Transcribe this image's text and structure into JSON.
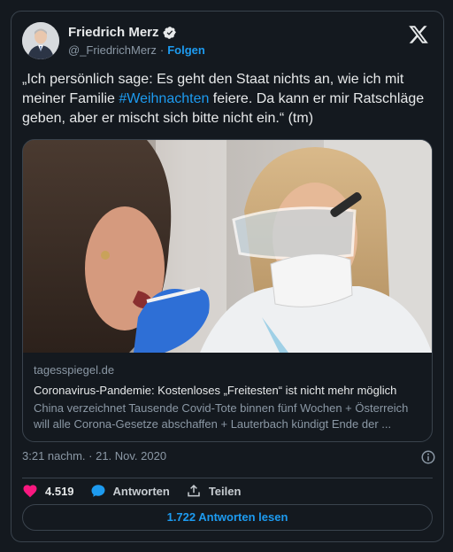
{
  "author": {
    "name": "Friedrich Merz",
    "handle": "@_FriedrichMerz",
    "separator": "·",
    "follow_label": "Folgen"
  },
  "tweet": {
    "text_before": "„Ich persönlich sage: Es geht den Staat nichts an, wie ich mit meiner Familie ",
    "hashtag": "#Weihnachten",
    "text_after": " feiere. Da kann er mir Ratschläge geben, aber er mischt sich bitte nicht ein.“ (tm)",
    "timestamp": "3:21 nachm. · 21. Nov. 2020"
  },
  "link_card": {
    "domain": "tagesspiegel.de",
    "headline": "Coronavirus-Pandemie: Kostenloses „Freitesten“ ist nicht mehr möglich",
    "description": "China verzeichnet Tausende Covid-Tote binnen fünf Wochen + Österreich will alle Corona-Gesetze abschaffen + Lauterbach kündigt Ende der ..."
  },
  "actions": {
    "likes_count": "4.519",
    "reply_label": "Antworten",
    "share_label": "Teilen",
    "read_replies_label": "1.722 Antworten lesen"
  },
  "colors": {
    "background": "#14191f",
    "accent": "#1d9bf0",
    "like": "#f91880",
    "secondary_text": "#8b98a5"
  },
  "icons": [
    "verified-badge-icon",
    "x-logo-icon",
    "info-icon",
    "heart-icon",
    "reply-bubble-icon",
    "share-upload-icon"
  ]
}
